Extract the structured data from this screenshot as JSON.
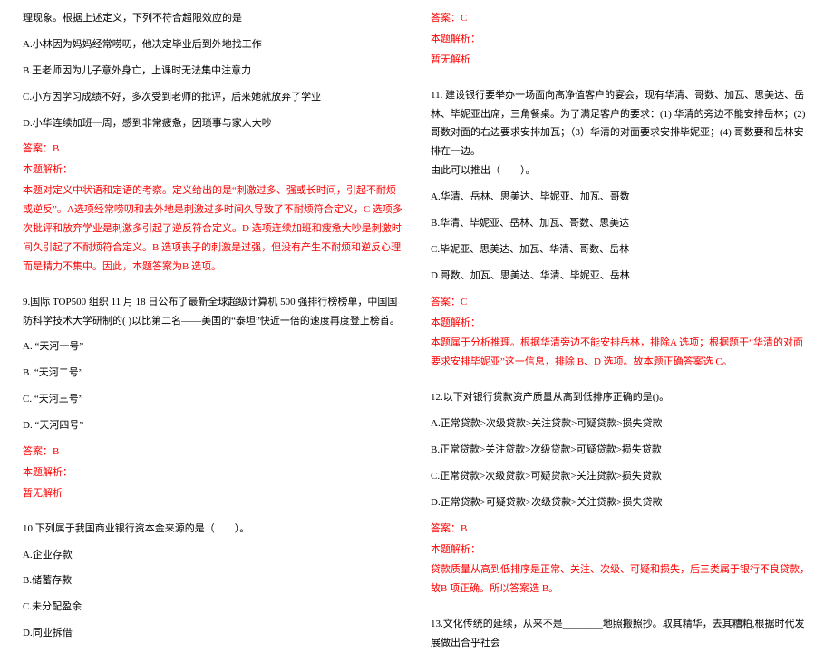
{
  "left": {
    "intro": "理现象。根据上述定义，下列不符合超限效应的是",
    "q_optA": "A.小林因为妈妈经常唠叨，他决定毕业后到外地找工作",
    "q_optB": "B.王老师因为儿子意外身亡，上课时无法集中注意力",
    "q_optC": "C.小方因学习成绩不好，多次受到老师的批评，后来她就放弃了学业",
    "q_optD": "D.小华连续加班一周，感到非常疲惫，因琐事与家人大吵",
    "q_ans": "答案：B",
    "q_analysis_label": "本题解析：",
    "q_analysis": "本题对定义中状语和定语的考察。定义给出的是“刺激过多、强或长时间，引起不耐烦或逆反”。A选项经常唠叨和去外地是刺激过多时间久导致了不耐烦符合定义，C 选项多次批评和放弃学业是刺激多引起了逆反符合定义。D 选项连续加班和疲惫大吵是刺激时间久引起了不耐烦符合定义。B 选项丧子的刺激是过强，但没有产生不耐烦和逆反心理而是精力不集中。因此，本题答案为B 选项。",
    "q9_stem": "9.国际 TOP500 组织 11 月 18 日公布了最新全球超级计算机 500 强排行榜榜单，中国国防科学技术大学研制的( )以比第二名——美国的“泰坦”快近一倍的速度再度登上榜首。",
    "q9_optA": "A. “天河一号”",
    "q9_optB": "B. “天河二号”",
    "q9_optC": "C. “天河三号”",
    "q9_optD": "D. “天河四号”",
    "q9_ans": "答案：B",
    "q9_analysis_label": "本题解析：",
    "q9_analysis": "暂无解析",
    "q10_stem": "10.下列属于我国商业银行资本金来源的是（　　）。",
    "q10_optA": "A.企业存款",
    "q10_optB": "B.储蓄存款",
    "q10_optC": "C.未分配盈余",
    "q10_optD": "D.同业拆借"
  },
  "right": {
    "q10_ans": "答案：C",
    "q10_analysis_label": "本题解析：",
    "q10_analysis": "暂无解析",
    "q11_stem": "11. 建设银行要举办一场面向高净值客户的宴会，现有华清、哥数、加瓦、思美达、岳林、毕妮亚出席，三角餐桌。为了满足客户的要求：(1) 华清的旁边不能安排岳林；(2) 哥数对面的右边要求安排加瓦；（3）华清的对面要求安排毕妮亚；(4) 哥数要和岳林安排在一边。",
    "q11_stem2": "由此可以推出（　　）。",
    "q11_optA": "A.华清、岳林、思美达、毕妮亚、加瓦、哥数",
    "q11_optB": "B.华清、毕妮亚、岳林、加瓦、哥数、思美达",
    "q11_optC": "C.毕妮亚、思美达、加瓦、华清、哥数、岳林",
    "q11_optD": "D.哥数、加瓦、思美达、华清、毕妮亚、岳林",
    "q11_ans": "答案：C",
    "q11_analysis_label": "本题解析：",
    "q11_analysis": "本题属于分析推理。根据华清旁边不能安排岳林，排除A 选项；根据题干“华清的对面要求安排毕妮亚”这一信息，排除 B、D 选项。故本题正确答案选 C。",
    "q12_stem": "12.以下对银行贷款资产质量从高到低排序正确的是()。",
    "q12_optA": "A.正常贷款>次级贷款>关注贷款>可疑贷款>损失贷款",
    "q12_optB": "B.正常贷款>关注贷款>次级贷款>可疑贷款>损失贷款",
    "q12_optC": "C.正常贷款>次级贷款>可疑贷款>关注贷款>损失贷款",
    "q12_optD": "D.正常贷款>可疑贷款>次级贷款>关注贷款>损失贷款",
    "q12_ans": "答案：B",
    "q12_analysis_label": "本题解析：",
    "q12_analysis": "贷款质量从高到低排序是正常、关注、次级、可疑和损失，后三类属于银行不良贷款，故B 项正确。所以答案选 B。",
    "q13_stem": "13.文化传统的延续，从来不是________地照搬照抄。取其精华，去其糟粕,根据时代发展做出合乎社会"
  }
}
